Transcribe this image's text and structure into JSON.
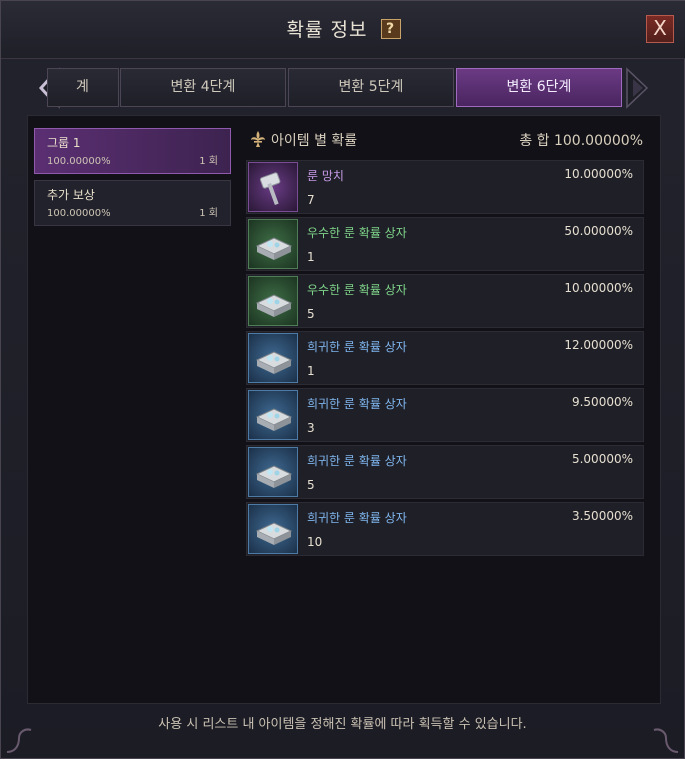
{
  "window": {
    "title": "확률 정보",
    "help_label": "?",
    "close_label": "X"
  },
  "tabs": [
    {
      "label": "계",
      "active": false
    },
    {
      "label": "변환 4단계",
      "active": false
    },
    {
      "label": "변환 5단계",
      "active": false
    },
    {
      "label": "변환 6단계",
      "active": true
    }
  ],
  "groups": [
    {
      "name": "그룹 1",
      "percent": "100.00000%",
      "count": "1 회",
      "active": true
    },
    {
      "name": "추가 보상",
      "percent": "100.00000%",
      "count": "1 회",
      "active": false
    }
  ],
  "list": {
    "title": "아이템 별 확률",
    "total": "총 합 100.00000%"
  },
  "items": [
    {
      "name": "룬 망치",
      "percent": "10.00000%",
      "quantity": "7",
      "grade": "purple",
      "icon": "hammer-icon"
    },
    {
      "name": "우수한 룬 확률 상자",
      "percent": "50.00000%",
      "quantity": "1",
      "grade": "green",
      "icon": "chest-icon"
    },
    {
      "name": "우수한 룬 확률 상자",
      "percent": "10.00000%",
      "quantity": "5",
      "grade": "green",
      "icon": "chest-icon"
    },
    {
      "name": "희귀한 룬 확률 상자",
      "percent": "12.00000%",
      "quantity": "1",
      "grade": "blue",
      "icon": "chest-icon"
    },
    {
      "name": "희귀한 룬 확률 상자",
      "percent": "9.50000%",
      "quantity": "3",
      "grade": "blue",
      "icon": "chest-icon"
    },
    {
      "name": "희귀한 룬 확률 상자",
      "percent": "5.00000%",
      "quantity": "5",
      "grade": "blue",
      "icon": "chest-icon"
    },
    {
      "name": "희귀한 룬 확률 상자",
      "percent": "3.50000%",
      "quantity": "10",
      "grade": "blue",
      "icon": "chest-icon"
    }
  ],
  "footer": {
    "note": "사용 시 리스트 내 아이템을 정해진 확률에 따라 획득할 수 있습니다."
  },
  "colors": {
    "accent_purple": "#6b3a84",
    "grade_purple": "#c79ae6",
    "grade_green": "#7fd58a",
    "grade_blue": "#7fb6ee"
  }
}
